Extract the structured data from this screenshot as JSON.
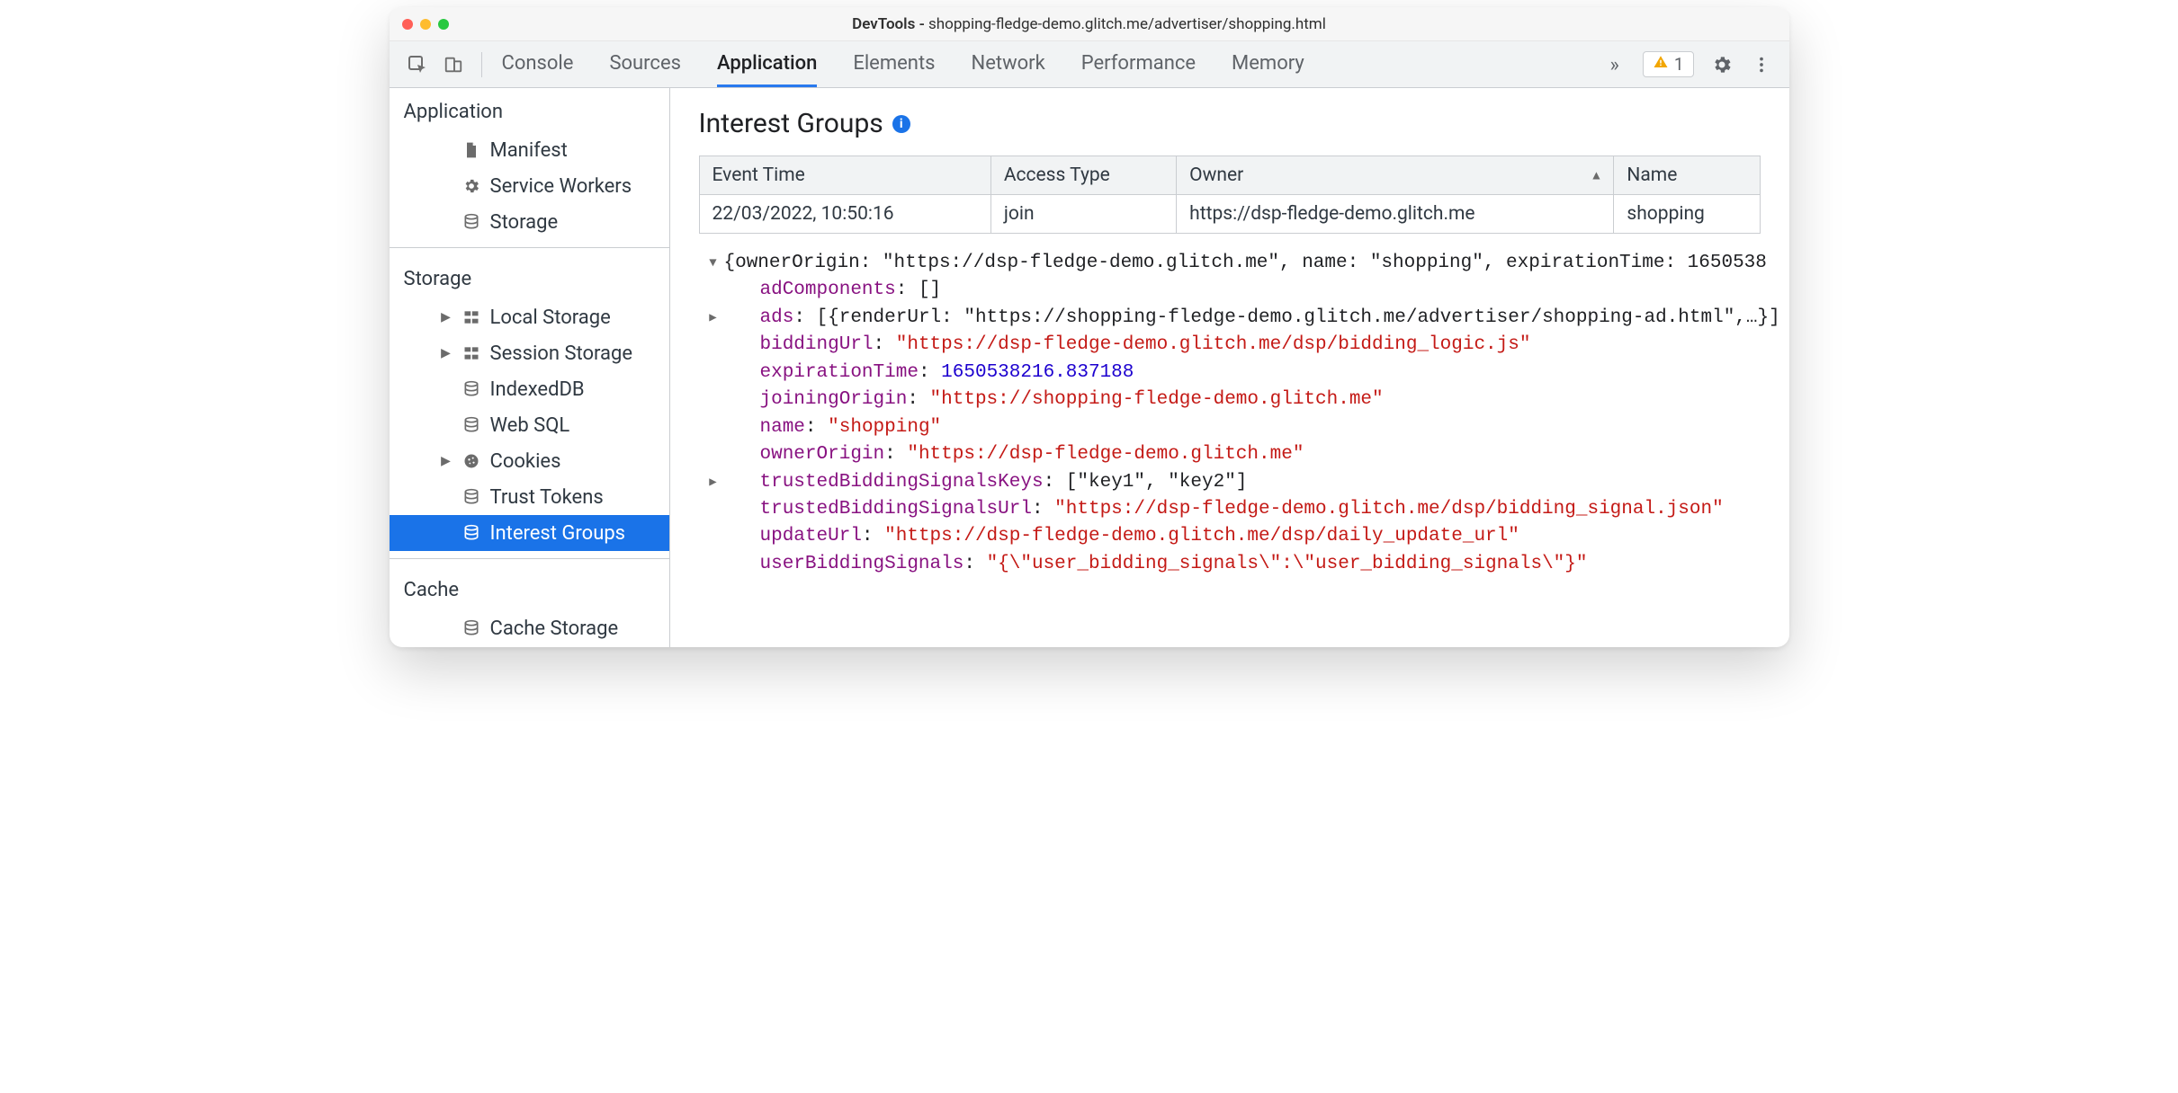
{
  "window": {
    "title_prefix": "DevTools - ",
    "title_url": "shopping-fledge-demo.glitch.me/advertiser/shopping.html"
  },
  "toolbar": {
    "tabs": [
      "Console",
      "Sources",
      "Application",
      "Elements",
      "Network",
      "Performance",
      "Memory"
    ],
    "active_tab_index": 2,
    "warnings_count": "1"
  },
  "sidebar": {
    "sections": [
      {
        "title": "Application",
        "items": [
          {
            "icon": "file",
            "label": "Manifest",
            "has_children": false
          },
          {
            "icon": "gear",
            "label": "Service Workers",
            "has_children": false
          },
          {
            "icon": "db",
            "label": "Storage",
            "has_children": false
          }
        ]
      },
      {
        "title": "Storage",
        "items": [
          {
            "icon": "grid",
            "label": "Local Storage",
            "has_children": true
          },
          {
            "icon": "grid",
            "label": "Session Storage",
            "has_children": true
          },
          {
            "icon": "db",
            "label": "IndexedDB",
            "has_children": false
          },
          {
            "icon": "db",
            "label": "Web SQL",
            "has_children": false
          },
          {
            "icon": "cookie",
            "label": "Cookies",
            "has_children": true
          },
          {
            "icon": "db",
            "label": "Trust Tokens",
            "has_children": false
          },
          {
            "icon": "db",
            "label": "Interest Groups",
            "has_children": false,
            "selected": true
          }
        ]
      },
      {
        "title": "Cache",
        "items": [
          {
            "icon": "db",
            "label": "Cache Storage",
            "has_children": false
          }
        ]
      }
    ]
  },
  "panel": {
    "title": "Interest Groups",
    "table": {
      "headers": [
        "Event Time",
        "Access Type",
        "Owner",
        "Name"
      ],
      "sort_col_index": 2,
      "rows": [
        {
          "event_time": "22/03/2022, 10:50:16",
          "access_type": "join",
          "owner": "https://dsp-fledge-demo.glitch.me",
          "name": "shopping"
        }
      ]
    },
    "details": {
      "top_summary": "{ownerOrigin: \"https://dsp-fledge-demo.glitch.me\", name: \"shopping\", expirationTime: 1650538",
      "adComponents": "[]",
      "ads_summary": "[{renderUrl: \"https://shopping-fledge-demo.glitch.me/advertiser/shopping-ad.html\",…}]",
      "biddingUrl": "\"https://dsp-fledge-demo.glitch.me/dsp/bidding_logic.js\"",
      "expirationTime": "1650538216.837188",
      "joiningOrigin": "\"https://shopping-fledge-demo.glitch.me\"",
      "name": "\"shopping\"",
      "ownerOrigin": "\"https://dsp-fledge-demo.glitch.me\"",
      "trustedBiddingSignalsKeys": "[\"key1\", \"key2\"]",
      "trustedBiddingSignalsUrl": "\"https://dsp-fledge-demo.glitch.me/dsp/bidding_signal.json\"",
      "updateUrl": "\"https://dsp-fledge-demo.glitch.me/dsp/daily_update_url\"",
      "userBiddingSignals": "\"{\\\"user_bidding_signals\\\":\\\"user_bidding_signals\\\"}\""
    }
  }
}
